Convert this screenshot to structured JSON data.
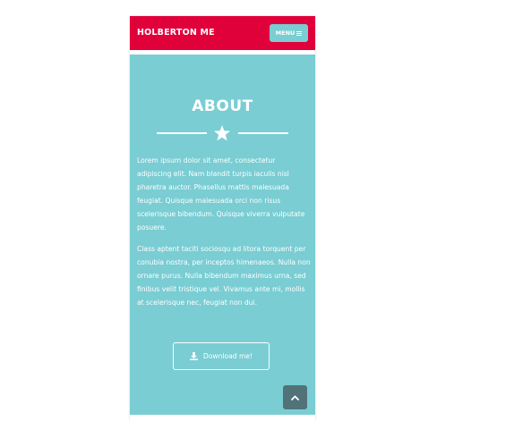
{
  "navbar": {
    "brand": "HOLBERTON ME",
    "menu_label": "MENU",
    "menu_icon": "hamburger-icon",
    "color": "#e0003a"
  },
  "about": {
    "title": "ABOUT",
    "divider_icon": "star-icon",
    "paragraphs": [
      "Lorem ipsum dolor sit amet, consectetur adipiscing elit. Nam blandit turpis iaculis nisl pharetra auctor. Phasellus mattis malesuada feugiat. Quisque malesuada orci non risus scelerisque bibendum. Quisque viverra vulputate posuere.",
      "Class aptent taciti sociosqu ad litora torquent per conubia nostra, per inceptos himenaeos. Nulla non ornare purus. Nulla bibendum maximus urna, sed finibus velit tristique vel. Vivamus ante mi, mollis at scelerisque nec, feugiat non dui."
    ],
    "download_label": "Download me!",
    "download_icon": "download-icon",
    "background": "#79cdd3"
  },
  "scroll_top": {
    "icon": "chevron-up-icon",
    "color": "#517378"
  }
}
